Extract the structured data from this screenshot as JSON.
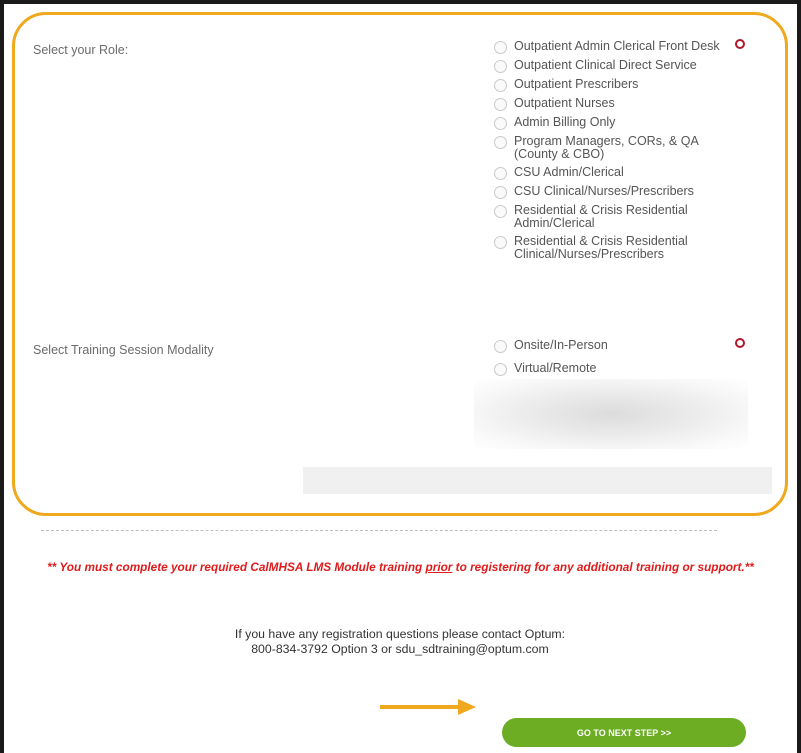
{
  "form": {
    "role_label": "Select your Role:",
    "role_options": [
      "Outpatient Admin Clerical Front Desk",
      "Outpatient Clinical Direct Service",
      "Outpatient Prescribers",
      "Outpatient Nurses",
      "Admin Billing Only",
      "Program Managers, CORs, & QA (County & CBO)",
      "CSU Admin/Clerical",
      "CSU Clinical/Nurses/Prescribers",
      "Residential & Crisis Residential Admin/Clerical",
      "Residential & Crisis Residential Clinical/Nurses/Prescribers"
    ],
    "modality_label": "Select Training Session Modality",
    "modality_options": [
      "Onsite/In-Person",
      "Virtual/Remote"
    ]
  },
  "notice": {
    "before": "** You must complete your required CalMHSA LMS Module training ",
    "underlined": "prior",
    "after": " to registering for any additional training or support.**"
  },
  "contact": {
    "line1": "If you have any registration questions please contact Optum:",
    "line2": "800-834-3792 Option 3 or sdu_sdtraining@optum.com"
  },
  "next_button": {
    "label": "GO TO NEXT STEP >>"
  },
  "colors": {
    "highlight": "#f0a81c",
    "required": "#b0172a",
    "warning": "#e11b1b",
    "button": "#6cad24"
  }
}
